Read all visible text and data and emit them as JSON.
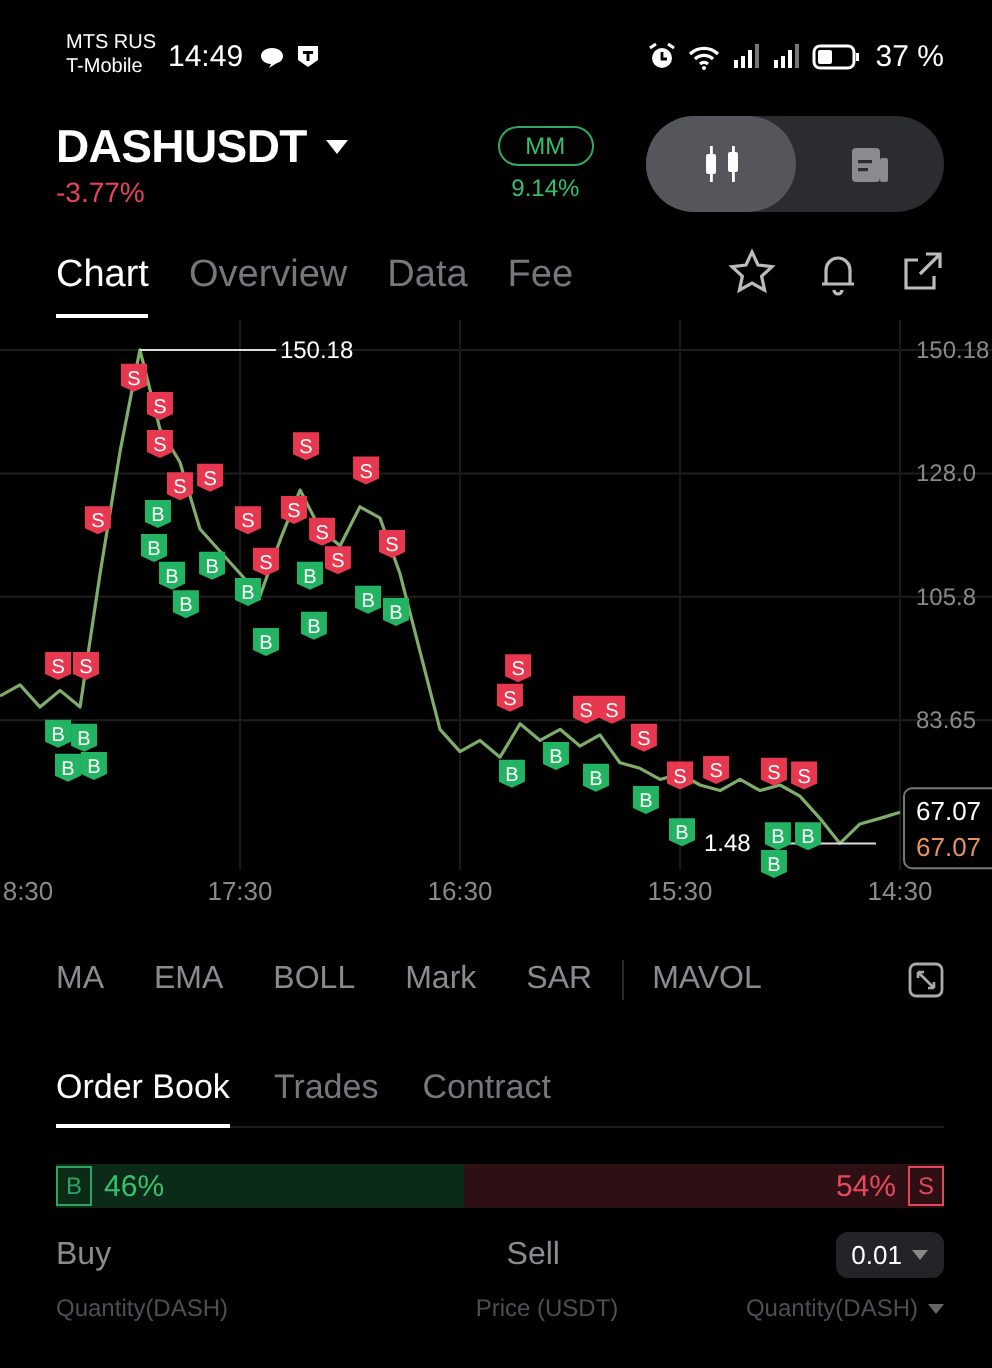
{
  "status_bar": {
    "carrier_1": "MTS RUS",
    "carrier_2": "T-Mobile",
    "time": "14:49",
    "battery": "37 %"
  },
  "header": {
    "symbol": "DASHUSDT",
    "change": "-3.77%",
    "badge": "MM",
    "badge_value": "9.14%",
    "view_toggle": [
      {
        "kind": "candles",
        "selected": true
      },
      {
        "kind": "document",
        "selected": false
      }
    ]
  },
  "tabs": [
    {
      "label": "Chart",
      "selected": true
    },
    {
      "label": "Overview",
      "selected": false
    },
    {
      "label": "Data",
      "selected": false
    },
    {
      "label": "Fee",
      "selected": false
    }
  ],
  "chart": {
    "high_label": "150.18",
    "low_label": "1.48",
    "last_price": "67.07",
    "mark_price": "67.07",
    "edge_tick_label": "8:30",
    "markers": [
      {
        "sell": true
      },
      {
        "sell": true
      },
      {
        "sell": true
      },
      {
        "sell": true
      },
      {
        "sell": true
      },
      {
        "sell": true
      },
      {
        "sell": true
      },
      {
        "sell": true
      },
      {
        "sell": true
      },
      {
        "sell": true
      },
      {
        "sell": true
      },
      {
        "sell": true
      },
      {
        "sell": true
      },
      {
        "sell": true
      },
      {
        "sell": true
      },
      {
        "sell": true
      },
      {
        "sell": true
      },
      {
        "sell": true
      },
      {
        "sell": true
      },
      {
        "sell": true
      },
      {
        "sell": true
      },
      {
        "sell": true
      },
      {
        "sell": true
      },
      {
        "sell": true
      },
      {
        "sell": true
      },
      {
        "sell": false
      },
      {
        "sell": false
      },
      {
        "sell": false
      },
      {
        "sell": false
      },
      {
        "sell": false
      },
      {
        "sell": false
      },
      {
        "sell": false
      },
      {
        "sell": false
      },
      {
        "sell": false
      },
      {
        "sell": false
      },
      {
        "sell": false
      },
      {
        "sell": false
      },
      {
        "sell": false
      },
      {
        "sell": false
      },
      {
        "sell": false
      },
      {
        "sell": false
      },
      {
        "sell": false
      },
      {
        "sell": false
      },
      {
        "sell": false
      },
      {
        "sell": false
      },
      {
        "sell": false
      },
      {
        "sell": false
      },
      {
        "sell": false
      }
    ],
    "chart_data": {
      "type": "line",
      "grid": true,
      "x": [
        18.591,
        18.5,
        18.409,
        18.318,
        18.227,
        18.136,
        18.045,
        17.955,
        17.864,
        17.773,
        17.682,
        17.591,
        17.5,
        17.409,
        17.318,
        17.227,
        17.136,
        17.045,
        16.955,
        16.864,
        16.773,
        16.682,
        16.591,
        16.5,
        16.409,
        16.318,
        16.227,
        16.136,
        16.045,
        15.955,
        15.864,
        15.773,
        15.682,
        15.591,
        15.5,
        15.409,
        15.318,
        15.227,
        15.136,
        15.045,
        14.955,
        14.864,
        14.773,
        14.682,
        14.591,
        14.5
      ],
      "series": [
        {
          "color": "#7fae6a",
          "values": [
            88,
            90,
            86,
            89,
            86,
            110,
            132,
            150.2,
            136,
            130,
            118,
            114,
            110,
            106,
            116,
            125,
            118,
            115,
            122,
            120,
            110,
            96,
            82,
            78,
            80,
            77,
            83,
            80,
            82,
            79,
            81,
            76,
            75,
            73,
            74,
            72,
            71,
            73,
            71,
            72,
            70,
            66,
            61.5,
            65,
            66,
            67.1
          ]
        }
      ],
      "xlim": [
        18.591,
        14.5
      ],
      "ylim": [
        56.72,
        155.57
      ],
      "xticks": [
        {
          "value": 17.5,
          "label": "17:30"
        },
        {
          "value": 16.5,
          "label": "16:30"
        },
        {
          "value": 15.5,
          "label": "15:30"
        },
        {
          "value": 14.5,
          "label": "14:30"
        }
      ],
      "yticks": [
        {
          "value": 150.18,
          "label": "150.18"
        },
        {
          "value": 128,
          "label": "128.0"
        },
        {
          "value": 105.83,
          "label": "105.8"
        },
        {
          "value": 83.65,
          "label": "83.65"
        }
      ],
      "annotations": [
        {
          "x": 18.146,
          "y": 119.6,
          "text": "S"
        },
        {
          "x": 17.982,
          "y": 145.2,
          "text": "S"
        },
        {
          "x": 17.864,
          "y": 140.1,
          "text": "S"
        },
        {
          "x": 17.864,
          "y": 133.3,
          "text": "S"
        },
        {
          "x": 17.636,
          "y": 127.2,
          "text": "S"
        },
        {
          "x": 17.773,
          "y": 125.7,
          "text": "S"
        },
        {
          "x": 17.464,
          "y": 119.6,
          "text": "S"
        },
        {
          "x": 17.382,
          "y": 112.1,
          "text": "S"
        },
        {
          "x": 17.2,
          "y": 132.9,
          "text": "S"
        },
        {
          "x": 17.255,
          "y": 121.4,
          "text": "S"
        },
        {
          "x": 17.127,
          "y": 117.5,
          "text": "S"
        },
        {
          "x": 17.055,
          "y": 112.4,
          "text": "S"
        },
        {
          "x": 16.927,
          "y": 128.5,
          "text": "S"
        },
        {
          "x": 16.809,
          "y": 115.3,
          "text": "S"
        },
        {
          "x": 18.327,
          "y": 93.4,
          "text": "S"
        },
        {
          "x": 18.2,
          "y": 93.4,
          "text": "S"
        },
        {
          "x": 16.236,
          "y": 93.0,
          "text": "S"
        },
        {
          "x": 16.273,
          "y": 87.7,
          "text": "S"
        },
        {
          "x": 15.927,
          "y": 85.5,
          "text": "S"
        },
        {
          "x": 15.809,
          "y": 85.5,
          "text": "S"
        },
        {
          "x": 15.664,
          "y": 80.5,
          "text": "S"
        },
        {
          "x": 15.5,
          "y": 73.7,
          "text": "S"
        },
        {
          "x": 15.336,
          "y": 74.7,
          "text": "S"
        },
        {
          "x": 15.073,
          "y": 74.4,
          "text": "S"
        },
        {
          "x": 14.936,
          "y": 73.7,
          "text": "S"
        },
        {
          "x": 18.327,
          "y": 81.2,
          "text": "B"
        },
        {
          "x": 18.209,
          "y": 80.5,
          "text": "B"
        },
        {
          "x": 18.282,
          "y": 75.1,
          "text": "B"
        },
        {
          "x": 18.164,
          "y": 75.4,
          "text": "B"
        },
        {
          "x": 17.873,
          "y": 120.7,
          "text": "B"
        },
        {
          "x": 17.891,
          "y": 114.6,
          "text": "B"
        },
        {
          "x": 17.809,
          "y": 109.6,
          "text": "B"
        },
        {
          "x": 17.746,
          "y": 104.5,
          "text": "B"
        },
        {
          "x": 17.627,
          "y": 111.4,
          "text": "B"
        },
        {
          "x": 17.464,
          "y": 106.7,
          "text": "B"
        },
        {
          "x": 17.382,
          "y": 97.7,
          "text": "B"
        },
        {
          "x": 17.182,
          "y": 109.6,
          "text": "B"
        },
        {
          "x": 17.164,
          "y": 100.6,
          "text": "B"
        },
        {
          "x": 16.918,
          "y": 105.3,
          "text": "B"
        },
        {
          "x": 16.791,
          "y": 103.1,
          "text": "B"
        },
        {
          "x": 16.264,
          "y": 74.0,
          "text": "B"
        },
        {
          "x": 16.064,
          "y": 77.2,
          "text": "B"
        },
        {
          "x": 15.882,
          "y": 73.3,
          "text": "B"
        },
        {
          "x": 15.655,
          "y": 69.3,
          "text": "B"
        },
        {
          "x": 15.491,
          "y": 63.5,
          "text": "B"
        },
        {
          "x": 15.055,
          "y": 62.8,
          "text": "B"
        },
        {
          "x": 15.073,
          "y": 57.8,
          "text": "B"
        },
        {
          "x": 14.918,
          "y": 62.8,
          "text": "B"
        }
      ]
    }
  },
  "indicators": [
    {
      "label": "MA",
      "divider_before": false
    },
    {
      "label": "EMA",
      "divider_before": false
    },
    {
      "label": "BOLL",
      "divider_before": false
    },
    {
      "label": "Mark",
      "divider_before": false
    },
    {
      "label": "SAR",
      "divider_before": false
    },
    {
      "label": "MAVOL",
      "divider_before": true
    }
  ],
  "order_book": {
    "tabs": [
      {
        "label": "Order Book",
        "selected": true
      },
      {
        "label": "Trades",
        "selected": false
      },
      {
        "label": "Contract",
        "selected": false
      }
    ],
    "buy_ratio": {
      "tag": "B",
      "value": "46%",
      "level": 0.46
    },
    "sell_ratio": {
      "tag": "S",
      "value": "54%"
    },
    "buy_label": "Buy",
    "sell_label": "Sell",
    "precision": "0.01",
    "columns": [
      "Quantity(DASH)",
      "Price (USDT)",
      "Quantity(DASH)"
    ]
  }
}
